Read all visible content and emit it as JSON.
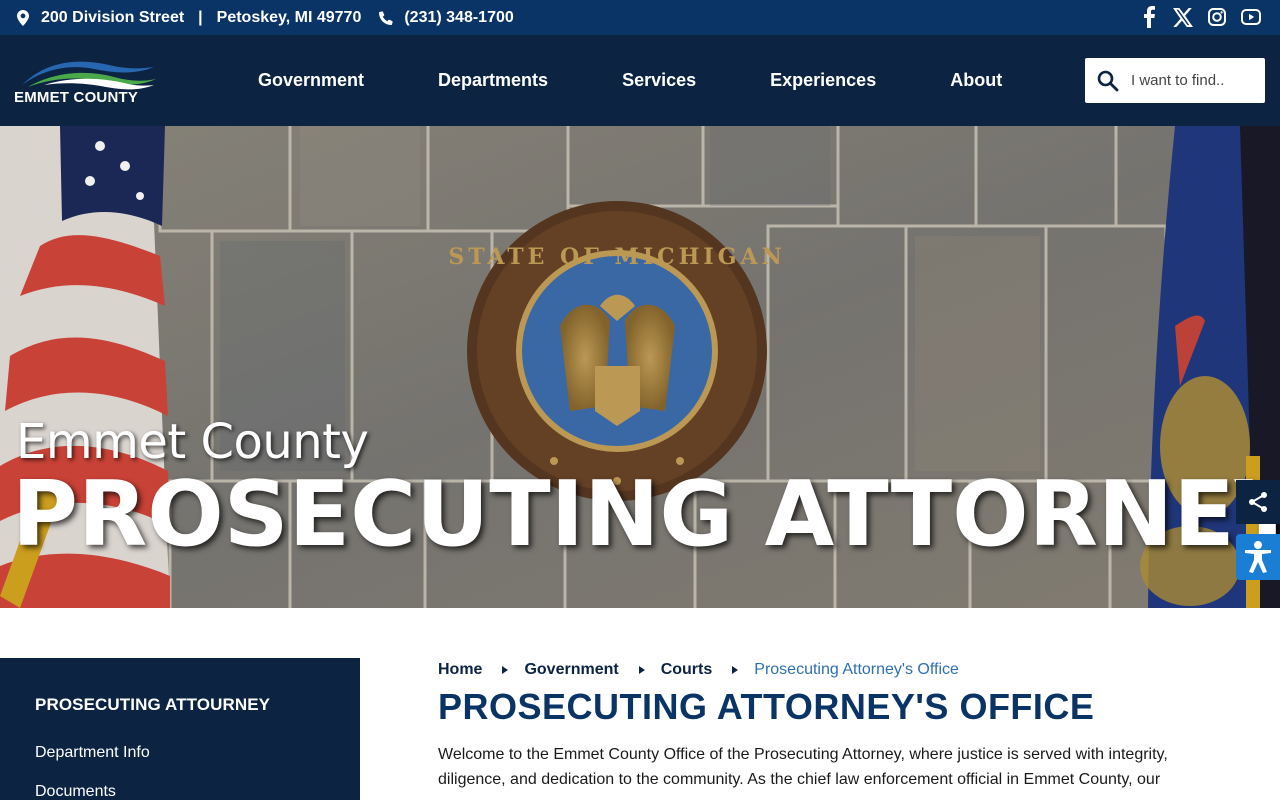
{
  "topbar": {
    "address": "200 Division Street",
    "separator": "|",
    "city": "Petoskey, MI 49770",
    "phone": "(231) 348-1700",
    "icons": [
      "map-pin-icon",
      "phone-icon"
    ],
    "social": [
      "facebook-icon",
      "x-icon",
      "instagram-icon",
      "youtube-icon"
    ]
  },
  "header": {
    "logo_text": "EMMET COUNTY",
    "nav": [
      "Government",
      "Departments",
      "Services",
      "Experiences",
      "About"
    ],
    "search_placeholder": "I want to find.."
  },
  "hero": {
    "subtitle": "Emmet County",
    "title": "PROSECUTING ATTORNEY",
    "seal_text": "STATE OF MICHIGAN"
  },
  "sidebar": {
    "title": "PROSECUTING ATTOURNEY",
    "items": [
      "Department Info",
      "Documents"
    ]
  },
  "breadcrumb": [
    "Home",
    "Government",
    "Courts",
    "Prosecuting Attorney's Office"
  ],
  "page": {
    "title": "PROSECUTING ATTORNEY'S OFFICE",
    "intro_line1": "Welcome to the Emmet County Office of the Prosecuting Attorney, where justice is served with integrity,",
    "intro_line2": "diligence, and dedication to the community. As the chief law enforcement official in Emmet County, our"
  },
  "colors": {
    "topbar": "#0a3466",
    "header": "#0d2342",
    "title": "#0a3466",
    "breadcrumb_current": "#2f6fb3",
    "accessibility": "#1a7fd4"
  }
}
